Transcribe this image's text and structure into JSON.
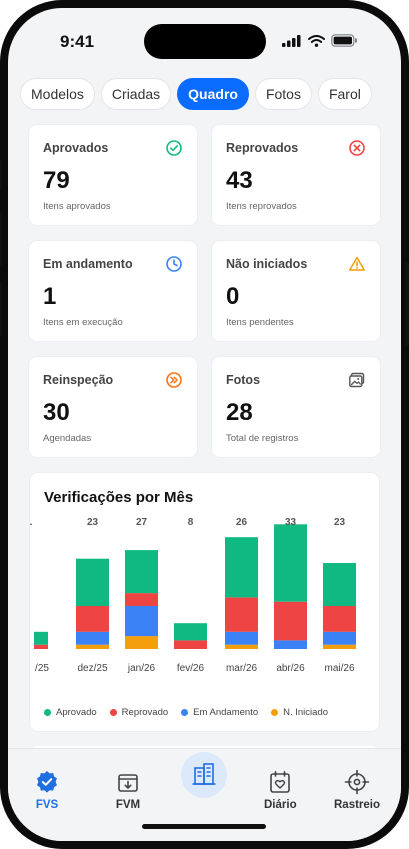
{
  "status": {
    "time": "9:41"
  },
  "tabs": [
    {
      "label": "Modelos",
      "active": false
    },
    {
      "label": "Criadas",
      "active": false
    },
    {
      "label": "Quadro",
      "active": true
    },
    {
      "label": "Fotos",
      "active": false
    },
    {
      "label": "Farol",
      "active": false
    }
  ],
  "cards": [
    {
      "title": "Aprovados",
      "value": "79",
      "subtitle": "Itens aprovados",
      "icon": "check-circle-icon",
      "color": "#10b981"
    },
    {
      "title": "Reprovados",
      "value": "43",
      "subtitle": "Itens reprovados",
      "icon": "x-circle-icon",
      "color": "#ef4444"
    },
    {
      "title": "Em andamento",
      "value": "1",
      "subtitle": "Itens em execução",
      "icon": "clock-icon",
      "color": "#3b82f6"
    },
    {
      "title": "Não iniciados",
      "value": "0",
      "subtitle": "Itens pendentes",
      "icon": "warning-icon",
      "color": "#f59e0b"
    },
    {
      "title": "Reinspeção",
      "value": "30",
      "subtitle": "Agendadas",
      "icon": "fast-forward-icon",
      "color": "#f97316"
    },
    {
      "title": "Fotos",
      "value": "28",
      "subtitle": "Total de registros",
      "icon": "photo-icon",
      "color": "#555555"
    }
  ],
  "chart_data": {
    "type": "bar",
    "stacked": true,
    "title": "Verificações por Mês",
    "categories": [
      "/25",
      "dez/25",
      "jan/26",
      "fev/26",
      "mar/26",
      "abr/26",
      "mai/26"
    ],
    "totals_labels": [
      ".",
      "23",
      "27",
      "8",
      "26",
      "33",
      "23"
    ],
    "series": [
      {
        "name": "Aprovado",
        "color": "#10b981",
        "values": [
          3,
          11,
          10,
          4,
          14,
          18,
          10
        ]
      },
      {
        "name": "Reprovado",
        "color": "#ef4444",
        "values": [
          1,
          6,
          3,
          2,
          8,
          9,
          6
        ]
      },
      {
        "name": "Em Andamento",
        "color": "#3b82f6",
        "values": [
          0,
          3,
          7,
          0,
          3,
          2,
          3
        ]
      },
      {
        "name": "N. Iniciado",
        "color": "#f59e0b",
        "values": [
          0,
          1,
          3,
          0,
          1,
          0,
          1
        ]
      }
    ],
    "legend_position": "bottom",
    "grid": false
  },
  "nav": [
    {
      "label": "FVS",
      "icon": "verified-badge-icon",
      "active": true
    },
    {
      "label": "FVM",
      "icon": "inbox-download-icon",
      "active": false
    },
    {
      "label": "",
      "icon": "buildings-icon",
      "active": false
    },
    {
      "label": "Diário",
      "icon": "calendar-heart-icon",
      "active": false
    },
    {
      "label": "Rastreio",
      "icon": "crosshair-icon",
      "active": false
    }
  ]
}
